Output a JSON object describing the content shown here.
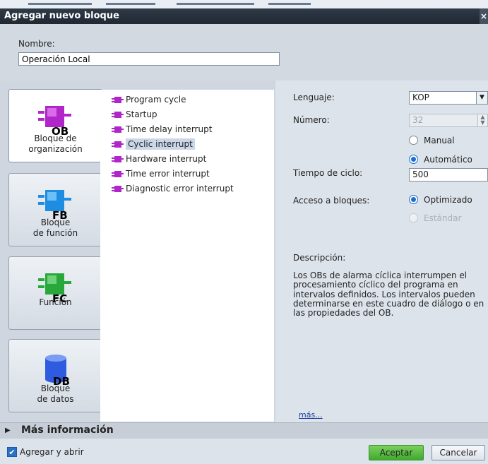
{
  "dialog": {
    "title": "Agregar nuevo bloque"
  },
  "name": {
    "label": "Nombre:",
    "value": "Operación Local"
  },
  "block_types": [
    {
      "lines": [
        "Bloque de",
        "organización"
      ],
      "code": "OB",
      "icon": "ob-block-icon",
      "color": "#b026c9",
      "selected": true
    },
    {
      "lines": [
        "Bloque",
        "de función"
      ],
      "code": "FB",
      "icon": "fb-block-icon",
      "color": "#1e8ce0",
      "selected": false
    },
    {
      "lines": [
        "Función"
      ],
      "code": "FC",
      "icon": "fc-block-icon",
      "color": "#28a83a",
      "selected": false
    },
    {
      "lines": [
        "Bloque",
        "de datos"
      ],
      "code": "DB",
      "icon": "db-block-icon",
      "color": "#2f5be0",
      "selected": false
    }
  ],
  "ob_list": [
    {
      "label": "Program cycle"
    },
    {
      "label": "Startup"
    },
    {
      "label": "Time delay interrupt"
    },
    {
      "label": "Cyclic interrupt",
      "selected": true
    },
    {
      "label": "Hardware interrupt"
    },
    {
      "label": "Time error interrupt"
    },
    {
      "label": "Diagnostic error interrupt"
    }
  ],
  "props": {
    "language_label": "Lenguaje:",
    "language_value": "KOP",
    "number_label": "Número:",
    "number_value": "32",
    "manual_label": "Manual",
    "auto_label": "Automático",
    "cycle_label": "Tiempo de ciclo:",
    "cycle_value": "500",
    "access_label": "Acceso a bloques:",
    "optimized_label": "Optimizado",
    "standard_label": "Estándar",
    "desc_label": "Descripción:",
    "desc_lines": [
      "Los OBs de alarma cíclica interrumpen el",
      "procesamiento cíclico del programa en",
      "intervalos definidos. Los intervalos pueden",
      "determinarse en este cuadro de diálogo o en",
      "las propiedades del OB."
    ],
    "more_link": "más..."
  },
  "more_info": "Más información",
  "footer": {
    "add_open_label": "Agregar y abrir",
    "ok_label": "Aceptar",
    "cancel_label": "Cancelar"
  },
  "colors": {
    "accent": "#1a6fd1",
    "ok_button": "#41a92f",
    "title_bar": "#1f2833",
    "ob_icon": "#b026c9"
  }
}
